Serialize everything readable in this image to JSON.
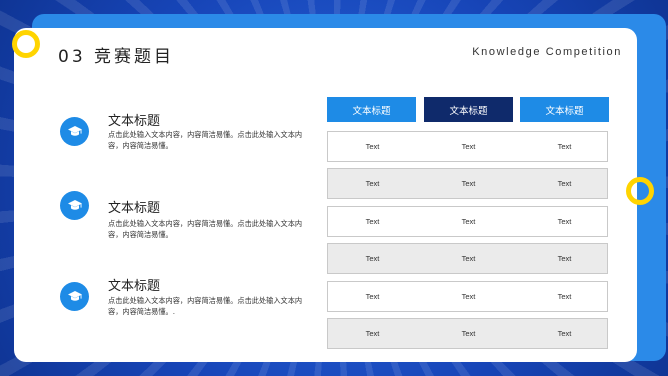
{
  "header": {
    "title": "03 竞赛题目",
    "subtitle": "Knowledge Competition"
  },
  "items": [
    {
      "icon": "graduation-cap-icon",
      "title": "文本标题",
      "desc": "点击此处输入文本内容，内容简洁易懂。点击此处输入文本内容，内容简洁易懂。"
    },
    {
      "icon": "graduation-cap-icon",
      "title": "文本标题",
      "desc": "点击此处输入文本内容，内容简洁易懂。点击此处输入文本内容，内容简洁易懂。"
    },
    {
      "icon": "graduation-cap-icon",
      "title": "文本标题",
      "desc": "点击此处输入文本内容，内容简洁易懂。点击此处输入文本内容，内容简洁易懂。."
    }
  ],
  "table": {
    "headers": [
      "文本标题",
      "文本标题",
      "文本标题"
    ],
    "header_colors": [
      "#1e8be6",
      "#0f2a6b",
      "#1e8be6"
    ],
    "rows": [
      [
        "Text",
        "Text",
        "Text"
      ],
      [
        "Text",
        "Text",
        "Text"
      ],
      [
        "Text",
        "Text",
        "Text"
      ],
      [
        "Text",
        "Text",
        "Text"
      ],
      [
        "Text",
        "Text",
        "Text"
      ],
      [
        "Text",
        "Text",
        "Text"
      ]
    ]
  },
  "colors": {
    "accent": "#1e8be6",
    "dark_accent": "#0f2a6b",
    "ring": "#ffd400"
  }
}
